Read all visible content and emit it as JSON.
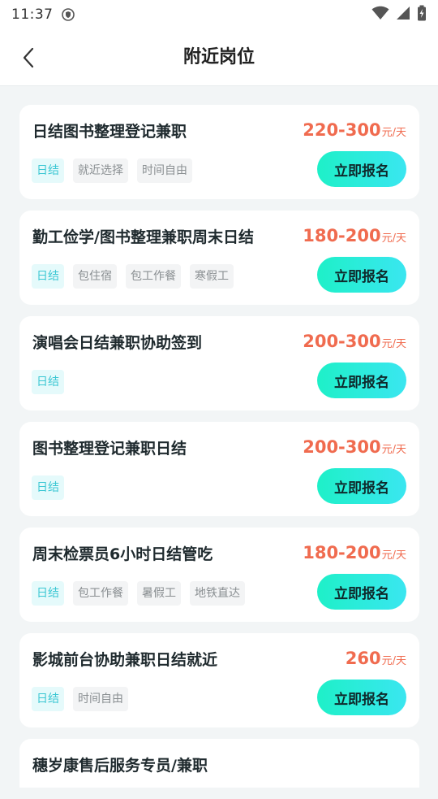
{
  "status_bar": {
    "time": "11:37",
    "icons": [
      "shield-icon",
      "wifi-icon",
      "signal-icon",
      "battery-icon"
    ]
  },
  "header": {
    "title": "附近岗位",
    "back_icon": "chevron-left-icon"
  },
  "jobs": [
    {
      "title": "日结图书整理登记兼职",
      "salary": "220-300",
      "unit": "元/天",
      "tags": [
        "日结",
        "就近选择",
        "时间自由"
      ],
      "apply_label": "立即报名"
    },
    {
      "title": "勤工俭学/图书整理兼职周末日结",
      "salary": "180-200",
      "unit": "元/天",
      "tags": [
        "日结",
        "包住宿",
        "包工作餐",
        "寒假工"
      ],
      "apply_label": "立即报名"
    },
    {
      "title": "演唱会日结兼职协助签到",
      "salary": "200-300",
      "unit": "元/天",
      "tags": [
        "日结"
      ],
      "apply_label": "立即报名"
    },
    {
      "title": "图书整理登记兼职日结",
      "salary": "200-300",
      "unit": "元/天",
      "tags": [
        "日结"
      ],
      "apply_label": "立即报名"
    },
    {
      "title": "周末检票员6小时日结管吃",
      "salary": "180-200",
      "unit": "元/天",
      "tags": [
        "日结",
        "包工作餐",
        "暑假工",
        "地铁直达"
      ],
      "apply_label": "立即报名"
    },
    {
      "title": "影城前台协助兼职日结就近",
      "salary": "260",
      "unit": "元/天",
      "tags": [
        "日结",
        "时间自由"
      ],
      "apply_label": "立即报名"
    },
    {
      "title": "穗岁康售后服务专员/兼职"
    }
  ],
  "colors": {
    "accent_salary": "#f06b4f",
    "tag_primary": "#3bc7d3",
    "button_gradient_start": "#1ef0c8",
    "button_gradient_end": "#3ae6f0"
  }
}
